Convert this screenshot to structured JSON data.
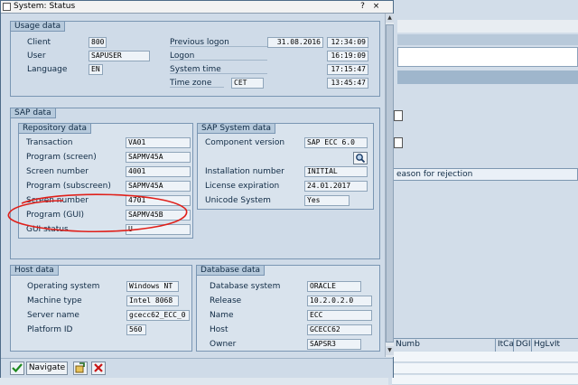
{
  "window": {
    "title": "System: Status",
    "help_label": "?",
    "close_label": "×"
  },
  "usage": {
    "title": "Usage data",
    "client_label": "Client",
    "client_value": "800",
    "user_label": "User",
    "user_value": "SAPUSER",
    "language_label": "Language",
    "language_value": "EN",
    "prev_logon_label": "Previous logon",
    "prev_logon_date": "31.08.2016",
    "prev_logon_time": "12:34:09",
    "logon_label": "Logon",
    "logon_time": "16:19:09",
    "system_time_label": "System time",
    "system_time": "17:15:47",
    "time_zone_label": "Time zone",
    "time_zone_value": "CET",
    "time_zone_time": "13:45:47"
  },
  "sap": {
    "title": "SAP data",
    "repo": {
      "title": "Repository data",
      "transaction_label": "Transaction",
      "transaction_value": "VA01",
      "program_screen_label": "Program (screen)",
      "program_screen_value": "SAPMV45A",
      "screen_number_label": "Screen number",
      "screen_number_value": "4001",
      "program_subscreen_label": "Program (subscreen)",
      "program_subscreen_value": "SAPMV45A",
      "screen_number2_label": "Screen number",
      "screen_number2_value": "4701",
      "program_gui_label": "Program (GUI)",
      "program_gui_value": "SAPMV45B",
      "gui_status_label": "GUI status",
      "gui_status_value": "U"
    },
    "system": {
      "title": "SAP System data",
      "component_label": "Component version",
      "component_value": "SAP ECC 6.0",
      "installation_label": "Installation number",
      "installation_value": "INITIAL",
      "license_label": "License expiration",
      "license_value": "24.01.2017",
      "unicode_label": "Unicode System",
      "unicode_value": "Yes"
    }
  },
  "host": {
    "title": "Host data",
    "os_label": "Operating system",
    "os_value": "Windows NT",
    "machine_label": "Machine type",
    "machine_value": "Intel 8068",
    "server_label": "Server name",
    "server_value": "gcecc62_ECC_0",
    "platform_label": "Platform ID",
    "platform_value": "560"
  },
  "db": {
    "title": "Database data",
    "system_label": "Database system",
    "system_value": "ORACLE",
    "release_label": "Release",
    "release_value": "10.2.0.2.0",
    "name_label": "Name",
    "name_value": "ECC",
    "host_label": "Host",
    "host_value": "GCECC62",
    "owner_label": "Owner",
    "owner_value": "SAPSR3"
  },
  "footer": {
    "navigate_label": "Navigate"
  },
  "background": {
    "reason_tab": "eason for rejection",
    "col_numb": "Numb",
    "col_itca": "ItCa",
    "col_dgi": "DGI",
    "col_hglvit": "HgLvIt"
  },
  "colors": {
    "annotation": "#e0201a",
    "dialog_bg": "#cfdbe8",
    "group_header": "#b7cadc"
  }
}
